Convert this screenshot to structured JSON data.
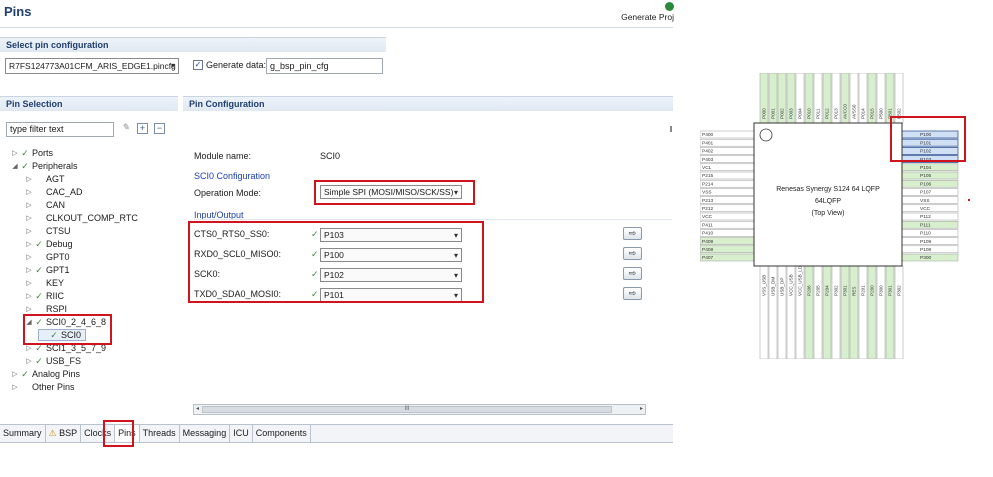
{
  "header": {
    "title": "Pins",
    "generate_label": "Generate Proj"
  },
  "pin_config_select": {
    "section_title": "Select pin configuration",
    "selected": "R7FS124773A01CFM_ARIS_EDGE1.pincfg",
    "generate_data_label": "Generate data:",
    "generate_data_checked": true,
    "generate_data_value": "g_bsp_pin_cfg"
  },
  "pin_selection": {
    "section_title": "Pin Selection",
    "filter_placeholder": "type filter text",
    "tree": [
      {
        "label": "Ports",
        "level": 0,
        "twisty": "collapsed",
        "checked": true
      },
      {
        "label": "Peripherals",
        "level": 0,
        "twisty": "expanded",
        "checked": true
      },
      {
        "label": "AGT",
        "level": 1,
        "twisty": "collapsed",
        "checked": false
      },
      {
        "label": "CAC_AD",
        "level": 1,
        "twisty": "collapsed",
        "checked": false
      },
      {
        "label": "CAN",
        "level": 1,
        "twisty": "collapsed",
        "checked": false
      },
      {
        "label": "CLKOUT_COMP_RTC",
        "level": 1,
        "twisty": "collapsed",
        "checked": false
      },
      {
        "label": "CTSU",
        "level": 1,
        "twisty": "collapsed",
        "checked": false
      },
      {
        "label": "Debug",
        "level": 1,
        "twisty": "collapsed",
        "checked": true
      },
      {
        "label": "GPT0",
        "level": 1,
        "twisty": "collapsed",
        "checked": false
      },
      {
        "label": "GPT1",
        "level": 1,
        "twisty": "collapsed",
        "checked": true
      },
      {
        "label": "KEY",
        "level": 1,
        "twisty": "collapsed",
        "checked": false
      },
      {
        "label": "RIIC",
        "level": 1,
        "twisty": "collapsed",
        "checked": true
      },
      {
        "label": "RSPI",
        "level": 1,
        "twisty": "collapsed",
        "checked": false
      },
      {
        "label": "SCI0_2_4_6_8",
        "level": 1,
        "twisty": "expanded",
        "checked": true
      },
      {
        "label": "SCI0",
        "level": 2,
        "twisty": "none",
        "checked": true
      },
      {
        "label": "SCI1_3_5_7_9",
        "level": 1,
        "twisty": "collapsed",
        "checked": true
      },
      {
        "label": "USB_FS",
        "level": 1,
        "twisty": "collapsed",
        "checked": true
      },
      {
        "label": "Analog Pins",
        "level": 0,
        "twisty": "collapsed",
        "checked": true
      },
      {
        "label": "Other Pins",
        "level": 0,
        "twisty": "collapsed",
        "checked": false
      }
    ]
  },
  "pin_configuration": {
    "section_title": "Pin Configuration",
    "module_name_label": "Module name:",
    "module_name_value": "SCI0",
    "config_heading": "SCI0 Configuration",
    "operation_mode_label": "Operation Mode:",
    "operation_mode_value": "Simple SPI (MOSI/MISO/SCK/SS)",
    "io_heading": "Input/Output",
    "io_rows": [
      {
        "label": "CTS0_RTS0_SS0:",
        "pin": "P103"
      },
      {
        "label": "RXD0_SCL0_MISO0:",
        "pin": "P100"
      },
      {
        "label": "SCK0:",
        "pin": "P102"
      },
      {
        "label": "TXD0_SDA0_MOSI0:",
        "pin": "P101"
      }
    ],
    "scroll_grip": "III"
  },
  "tabs": [
    {
      "label": "Summary",
      "icon": false
    },
    {
      "label": "BSP",
      "icon": true
    },
    {
      "label": "Clocks",
      "icon": false
    },
    {
      "label": "Pins",
      "icon": false,
      "active": true
    },
    {
      "label": "Threads",
      "icon": false
    },
    {
      "label": "Messaging",
      "icon": false
    },
    {
      "label": "ICU",
      "icon": false
    },
    {
      "label": "Components",
      "icon": false
    }
  ],
  "chip": {
    "name_line1": "Renesas Synergy S124 64 LQFP",
    "name_line2": "64LQFP",
    "name_line3": "(Top View)",
    "top_pins": [
      "P000",
      "P001",
      "P002",
      "P003",
      "P004",
      "P010",
      "P011",
      "P012",
      "P013",
      "AVCC0",
      "AVSS0",
      "P014",
      "P015",
      "P500",
      "P501",
      "P502"
    ],
    "left_pins": [
      "P400",
      "P401",
      "P402",
      "P403",
      "VCL",
      "P215",
      "P214",
      "VSS",
      "P213",
      "P212",
      "VCC",
      "P411",
      "P410",
      "P409",
      "P408",
      "P407"
    ],
    "right_pins": [
      "P100",
      "P101",
      "P102",
      "P103",
      "P104",
      "P105",
      "P106",
      "P107",
      "VSS",
      "VCC",
      "P112",
      "P111",
      "P110",
      "P109",
      "P108",
      "P300"
    ],
    "bottom_pins": [
      "VSS_USB",
      "USB_DM",
      "USB_DP",
      "VCC_USB",
      "VCC_USB_LDO",
      "P206",
      "P205",
      "P204",
      "P302",
      "P301",
      "RES",
      "P201",
      "P200",
      "P300",
      "P301",
      "P302"
    ],
    "colors": {
      "pin_used": "#d8efce",
      "pin_free": "#ffffff",
      "pin_selected": "#cfe0f5",
      "highlight": "#d0141d"
    }
  }
}
